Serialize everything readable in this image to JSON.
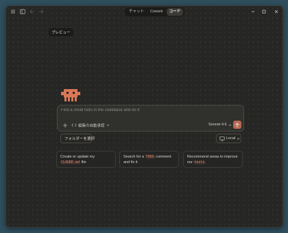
{
  "titlebar": {
    "tabs": [
      {
        "label": "チャット",
        "active": false
      },
      {
        "label": "Cowork",
        "active": false
      },
      {
        "label": "コード",
        "active": true
      }
    ]
  },
  "preview_chip": "プレビュー",
  "prompt": {
    "placeholder": "Find a small todo in the codebase and do it",
    "permission_label": "編集の自動承認",
    "model_label": "Sonnet 4.6"
  },
  "folder_button": "フォルダーを選択",
  "environment_button": "Local",
  "suggestions": [
    {
      "before": "Create or update my ",
      "code": "CLAUDE.md",
      "after": " file"
    },
    {
      "before": "Search for a ",
      "code": "TODO",
      "after": " comment and fix it"
    },
    {
      "before": "Recommend areas to improve our ",
      "code": "tests",
      "after": ""
    }
  ],
  "colors": {
    "window_bg": "#262624",
    "accent": "#b66a53",
    "mascot": "#d97757",
    "desktop": "#2f4f5e"
  },
  "icons": {
    "menu": "hamburger-menu-icon",
    "sidebar": "sidebar-toggle-icon",
    "back": "arrow-left-icon",
    "forward": "arrow-right-icon",
    "plus": "plus-icon",
    "code": "code-brackets-icon",
    "folder": "folder-icon",
    "monitor": "monitor-icon",
    "send": "arrow-up-icon"
  }
}
